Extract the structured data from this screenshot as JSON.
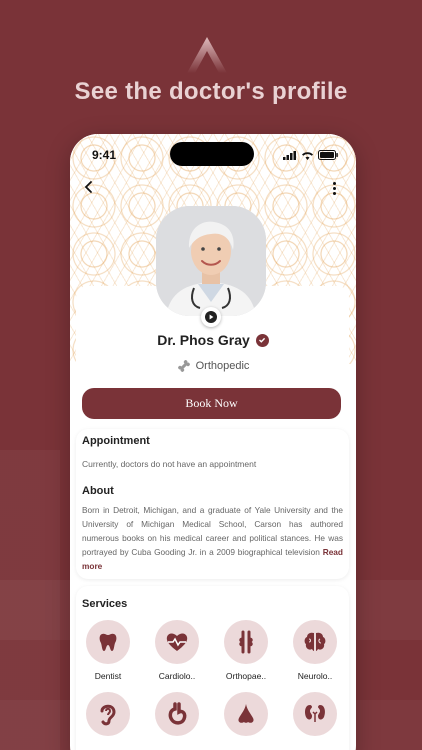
{
  "headline": "See the doctor's profile",
  "status_bar": {
    "time": "9:41"
  },
  "doctor": {
    "name": "Dr. Phos Gray",
    "specialty": "Orthopedic"
  },
  "book_button_label": "Book Now",
  "appointment": {
    "title": "Appointment",
    "text": "Currently, doctors do not have an appointment"
  },
  "about": {
    "title": "About",
    "text": "Born in Detroit, Michigan, and a graduate of Yale University and the University of Michigan Medical School, Carson has authored numerous books on his medical career and political stances. He was portrayed by Cuba Gooding Jr. in a 2009 biographical television",
    "read_more": "Read more"
  },
  "services": {
    "title": "Services",
    "items": [
      {
        "label": "Dentist",
        "icon": "tooth-icon"
      },
      {
        "label": "Cardiolo..",
        "icon": "heart-pulse-icon"
      },
      {
        "label": "Orthopae..",
        "icon": "bone-joint-icon"
      },
      {
        "label": "Neurolo..",
        "icon": "brain-icon"
      },
      {
        "label": "",
        "icon": "ear-icon"
      },
      {
        "label": "",
        "icon": "stomach-icon"
      },
      {
        "label": "",
        "icon": "nose-icon"
      },
      {
        "label": "",
        "icon": "kidney-icon"
      }
    ]
  },
  "colors": {
    "brand": "#7a3338",
    "service_circle": "#ecd9da",
    "pattern": "#e3a55c"
  }
}
